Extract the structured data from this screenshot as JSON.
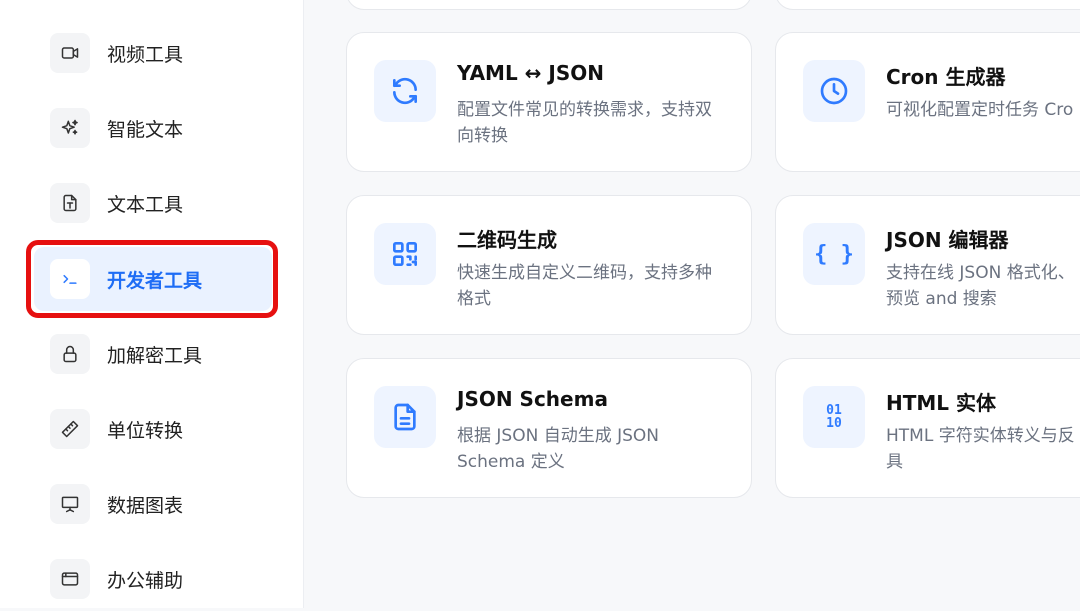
{
  "sidebar": {
    "items": [
      {
        "label": "视频工具",
        "icon": "video-icon"
      },
      {
        "label": "智能文本",
        "icon": "sparkles-icon"
      },
      {
        "label": "文本工具",
        "icon": "file-text-icon"
      },
      {
        "label": "开发者工具",
        "icon": "terminal-icon",
        "active": true
      },
      {
        "label": "加解密工具",
        "icon": "lock-icon"
      },
      {
        "label": "单位转换",
        "icon": "ruler-icon"
      },
      {
        "label": "数据图表",
        "icon": "presentation-chart-icon"
      },
      {
        "label": "办公辅助",
        "icon": "browser-window-icon"
      }
    ]
  },
  "cards": [
    {
      "title": "YAML ↔ JSON",
      "desc": "配置文件常见的转换需求，支持双向转换",
      "icon": "refresh-icon"
    },
    {
      "title": "Cron 生成器",
      "desc": "可视化配置定时任务 Cro",
      "icon": "clock-icon"
    },
    {
      "title": "二维码生成",
      "desc": "快速生成自定义二维码，支持多种格式",
      "icon": "qr-code-icon"
    },
    {
      "title": "JSON 编辑器",
      "desc": "支持在线 JSON 格式化、预览 and 搜索",
      "icon": "braces-icon",
      "icon_text": "{ }"
    },
    {
      "title": "JSON Schema",
      "desc": "根据 JSON 自动生成 JSON Schema 定义",
      "icon": "document-icon"
    },
    {
      "title": "HTML 实体",
      "desc": "HTML 字符实体转义与反具",
      "icon": "binary-icon",
      "icon_text_top": "01",
      "icon_text_bottom": "10"
    }
  ],
  "colors": {
    "accent": "#2f7bff",
    "active_bg": "#eaf2ff",
    "highlight": "#e61010"
  }
}
